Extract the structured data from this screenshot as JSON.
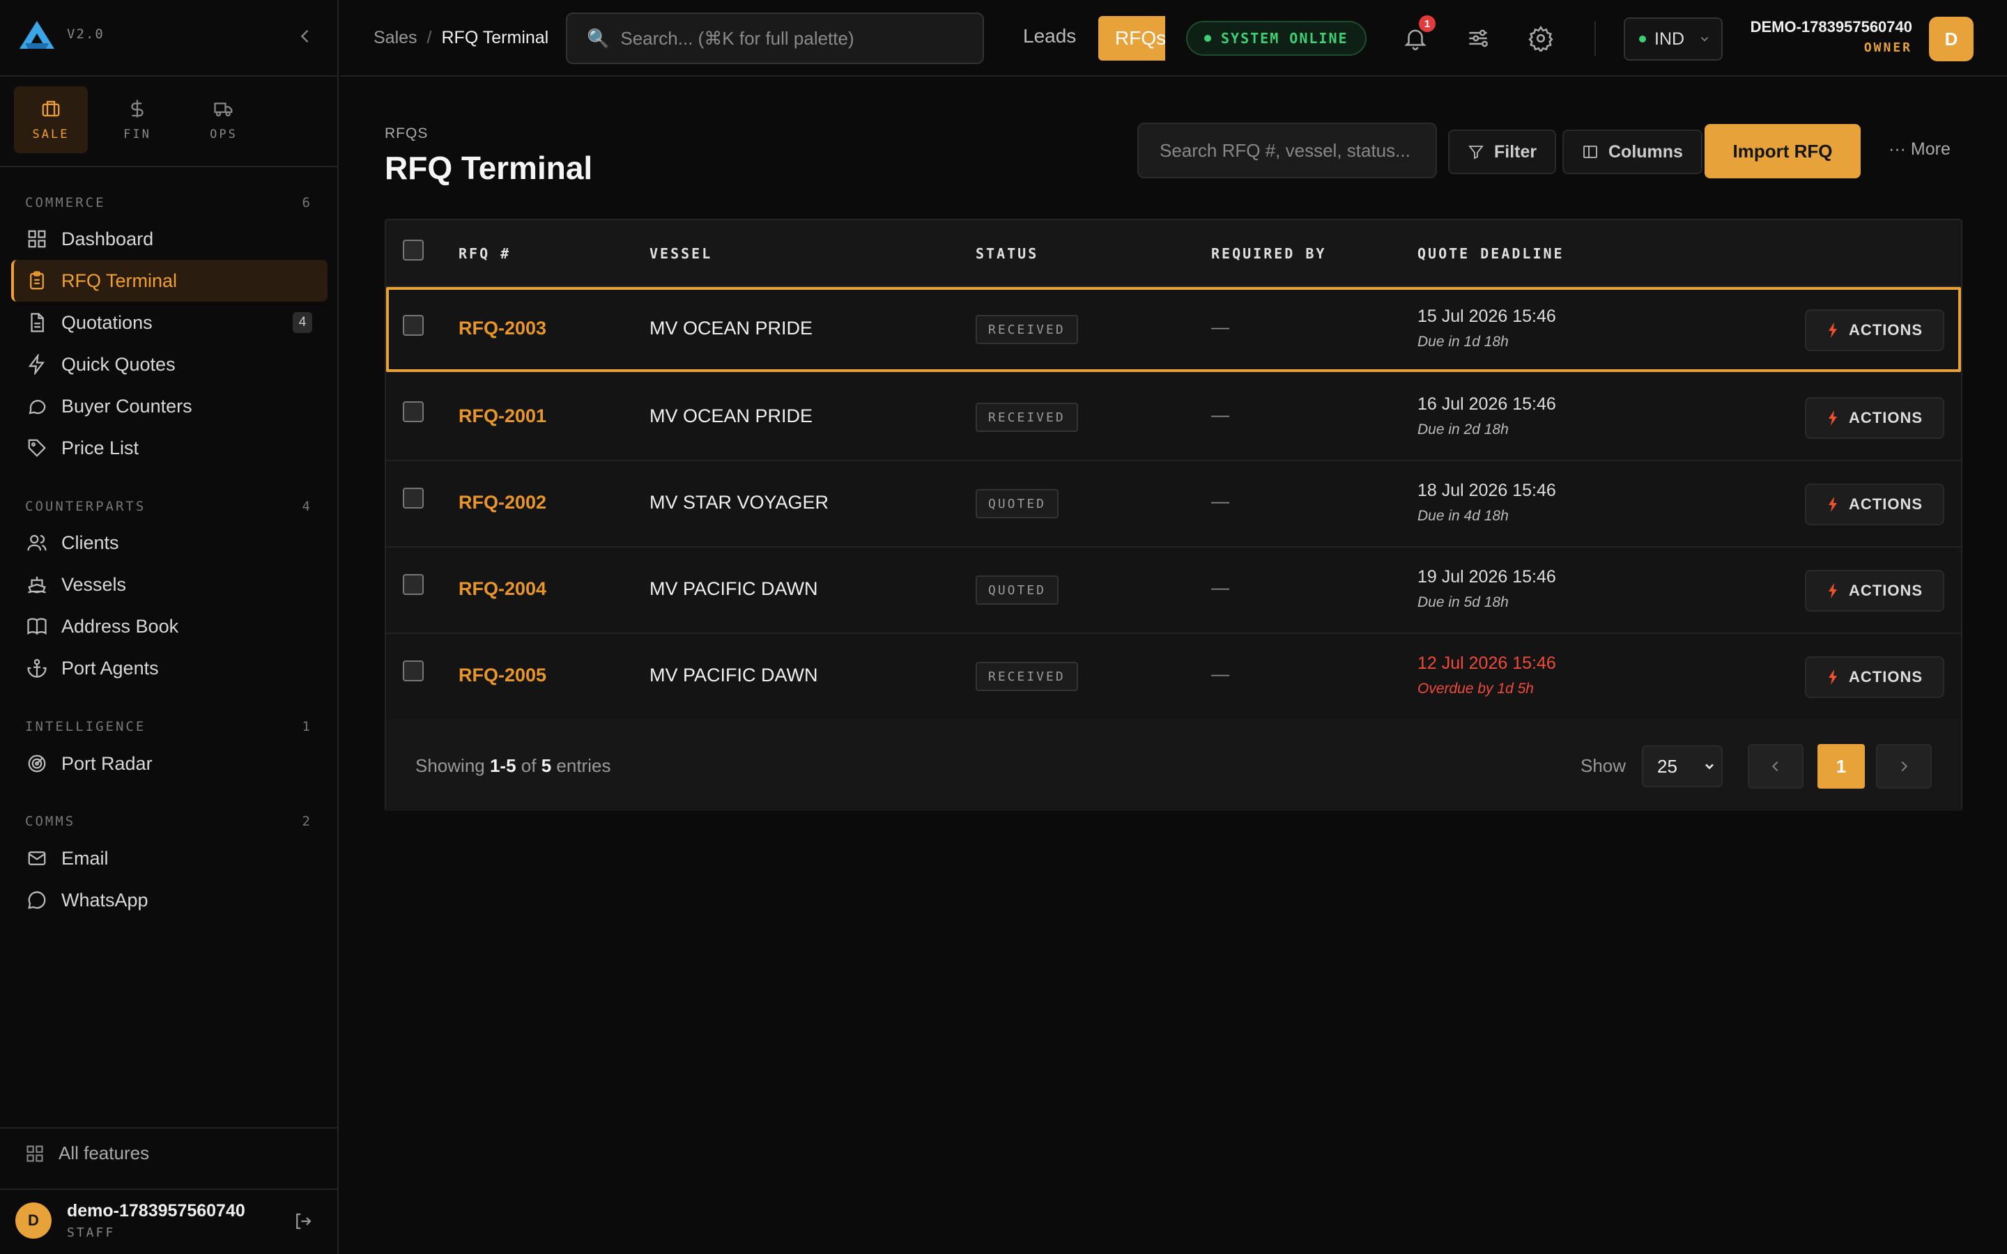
{
  "app": {
    "version": "V2.0",
    "accent_color": "#e8a23a",
    "modes": [
      {
        "label": "SALE",
        "icon": "briefcase-icon",
        "active": true
      },
      {
        "label": "FIN",
        "icon": "dollar-icon",
        "active": false
      },
      {
        "label": "OPS",
        "icon": "truck-icon",
        "active": false
      }
    ]
  },
  "sidebar": {
    "sections": [
      {
        "title": "COMMERCE",
        "count": "6"
      },
      {
        "title": "COUNTERPARTS",
        "count": "4"
      },
      {
        "title": "INTELLIGENCE",
        "count": "1"
      },
      {
        "title": "COMMS",
        "count": "2"
      }
    ],
    "items": [
      {
        "label": "Dashboard",
        "icon": "grid-icon"
      },
      {
        "label": "RFQ Terminal",
        "icon": "clipboard-icon",
        "active": true
      },
      {
        "label": "Quotations",
        "icon": "document-icon",
        "badge": "4"
      },
      {
        "label": "Quick Quotes",
        "icon": "bolt-icon"
      },
      {
        "label": "Buyer Counters",
        "icon": "chat-icon"
      },
      {
        "label": "Price List",
        "icon": "tag-icon"
      },
      {
        "label": "Clients",
        "icon": "users-icon"
      },
      {
        "label": "Vessels",
        "icon": "ship-icon"
      },
      {
        "label": "Address Book",
        "icon": "book-icon"
      },
      {
        "label": "Port Agents",
        "icon": "anchor-icon"
      },
      {
        "label": "Port Radar",
        "icon": "radar-icon"
      },
      {
        "label": "Email",
        "icon": "mail-icon"
      },
      {
        "label": "WhatsApp",
        "icon": "whatsapp-icon"
      }
    ],
    "all_features": "All features",
    "user": {
      "initial": "D",
      "name": "demo-1783957560740",
      "role": "STAFF"
    }
  },
  "topbar": {
    "breadcrumb": [
      "Sales",
      "/",
      "RFQ Terminal"
    ],
    "search_placeholder": "Search... (⌘K for full palette)",
    "nav_leads": "Leads",
    "nav_rfqs": "RFQs",
    "system_status": "SYSTEM ONLINE",
    "notification_count": "1",
    "region": "IND",
    "account": {
      "name": "DEMO-1783957560740",
      "role": "OWNER",
      "initial": "D"
    }
  },
  "page": {
    "eyebrow": "RFQS",
    "title": "RFQ Terminal",
    "search_placeholder": "Search RFQ #, vessel, status...",
    "filter_label": "Filter",
    "columns_label": "Columns",
    "import_label": "Import RFQ",
    "more_label": "··· More"
  },
  "table": {
    "headers": [
      "RFQ #",
      "VESSEL",
      "STATUS",
      "REQUIRED BY",
      "QUOTE DEADLINE"
    ],
    "action_label": "ACTIONS",
    "rows": [
      {
        "id": "RFQ-2003",
        "vessel": "MV OCEAN PRIDE",
        "status": "RECEIVED",
        "required_by": "—",
        "deadline": "15 Jul 2026 15:46",
        "due": "Due in 1d 18h",
        "selected": true,
        "overdue": false
      },
      {
        "id": "RFQ-2001",
        "vessel": "MV OCEAN PRIDE",
        "status": "RECEIVED",
        "required_by": "—",
        "deadline": "16 Jul 2026 15:46",
        "due": "Due in 2d 18h",
        "selected": false,
        "overdue": false
      },
      {
        "id": "RFQ-2002",
        "vessel": "MV STAR VOYAGER",
        "status": "QUOTED",
        "required_by": "—",
        "deadline": "18 Jul 2026 15:46",
        "due": "Due in 4d 18h",
        "selected": false,
        "overdue": false
      },
      {
        "id": "RFQ-2004",
        "vessel": "MV PACIFIC DAWN",
        "status": "QUOTED",
        "required_by": "—",
        "deadline": "19 Jul 2026 15:46",
        "due": "Due in 5d 18h",
        "selected": false,
        "overdue": false
      },
      {
        "id": "RFQ-2005",
        "vessel": "MV PACIFIC DAWN",
        "status": "RECEIVED",
        "required_by": "—",
        "deadline": "12 Jul 2026 15:46",
        "due": "Overdue by 1d 5h",
        "selected": false,
        "overdue": true
      }
    ]
  },
  "pagination": {
    "showing_prefix": "Showing",
    "range": "1-5",
    "of": "of",
    "total": "5",
    "suffix": "entries",
    "show_label": "Show",
    "page_size": "25",
    "current_page": "1"
  }
}
